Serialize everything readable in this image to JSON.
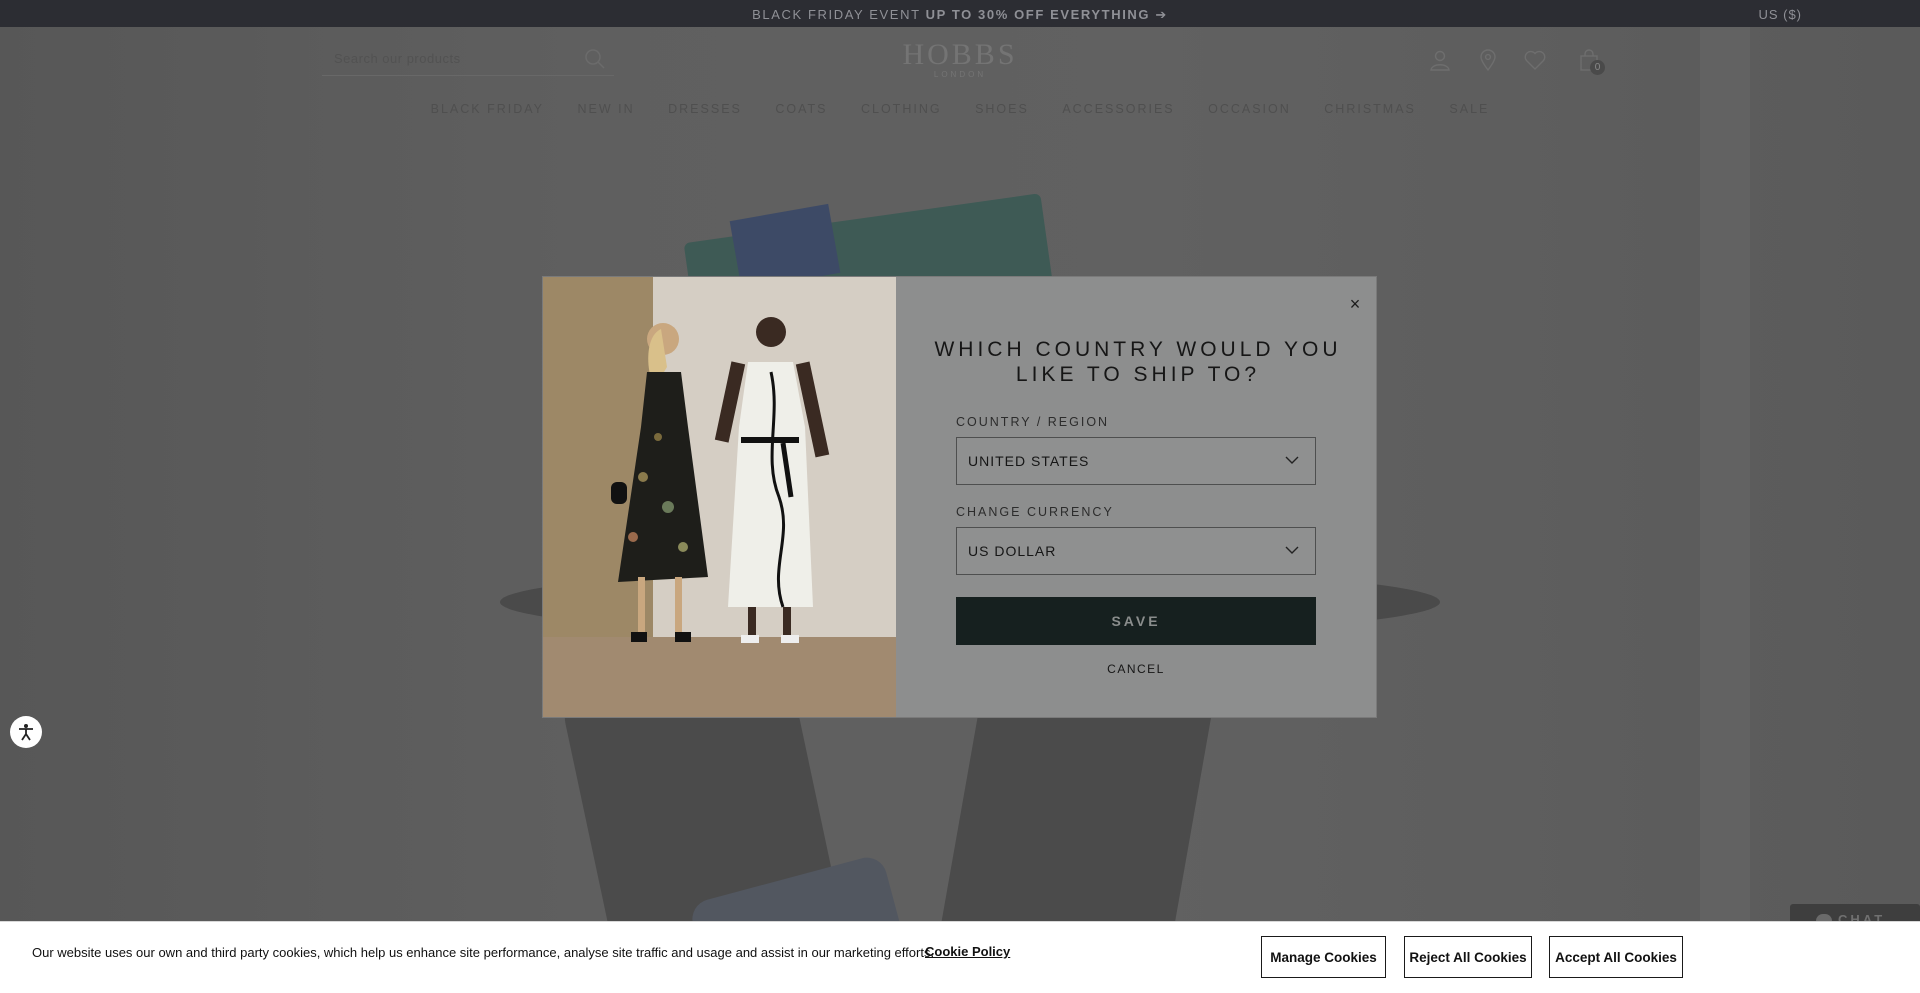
{
  "promo": {
    "text_normal": "BLACK FRIDAY EVENT ",
    "text_bold": "UP TO 30% OFF EVERYTHING",
    "arrow": "➔",
    "locale": "US ($)"
  },
  "header": {
    "search_placeholder": "Search our products",
    "logo": "HOBBS",
    "logo_sub": "LONDON",
    "bag_count": "0",
    "icons": [
      "account-icon",
      "store-locator-icon",
      "wishlist-heart-icon",
      "bag-icon"
    ]
  },
  "nav": {
    "items": [
      "BLACK FRIDAY",
      "NEW IN",
      "DRESSES",
      "COATS",
      "CLOTHING",
      "SHOES",
      "ACCESSORIES",
      "OCCASION",
      "CHRISTMAS",
      "SALE"
    ]
  },
  "modal": {
    "title": "WHICH COUNTRY WOULD YOU LIKE TO SHIP TO?",
    "country_label": "COUNTRY / REGION",
    "country_value": "UNITED STATES",
    "currency_label": "CHANGE CURRENCY",
    "currency_value": "US DOLLAR",
    "save_label": "SAVE",
    "cancel_label": "CANCEL",
    "close_glyph": "×"
  },
  "chat": {
    "label": "CHAT"
  },
  "cookie": {
    "text": "Our website uses our own and third party cookies, which help us enhance site performance, analyse site traffic and usage and assist in our marketing efforts.",
    "policy_link": "Cookie Policy",
    "manage_label": "Manage Cookies",
    "reject_label": "Reject All Cookies",
    "accept_label": "Accept All Cookies"
  },
  "colors": {
    "promo_bar": "#2c2d33",
    "overlay": "#5c5c5c",
    "modal_panel": "#8d8e8e",
    "save_button": "#16201f",
    "cookie_banner": "#ffffff"
  }
}
